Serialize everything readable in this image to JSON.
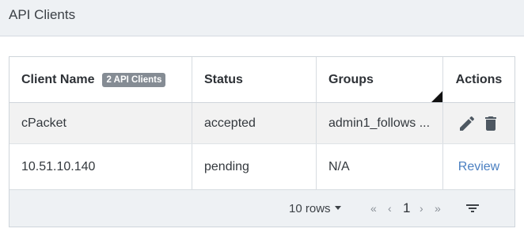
{
  "header": {
    "title": "API Clients"
  },
  "table": {
    "columns": {
      "client_name": "Client Name",
      "client_count_badge": "2 API Clients",
      "status": "Status",
      "groups": "Groups",
      "actions": "Actions"
    },
    "rows": [
      {
        "client_name": "cPacket",
        "status": "accepted",
        "groups": "admin1_follows ...",
        "actions": [
          "edit-icon",
          "delete-icon"
        ]
      },
      {
        "client_name": "10.51.10.140",
        "status": "pending",
        "groups": "N/A",
        "action_label": "Review"
      }
    ]
  },
  "footer": {
    "rows_per_page": "10 rows",
    "first": "«",
    "prev": "‹",
    "page": "1",
    "next": "›",
    "last": "»"
  },
  "colors": {
    "accent_link": "#4a7fc1",
    "badge_bg": "#858c94",
    "icon_color": "#4e5862"
  }
}
